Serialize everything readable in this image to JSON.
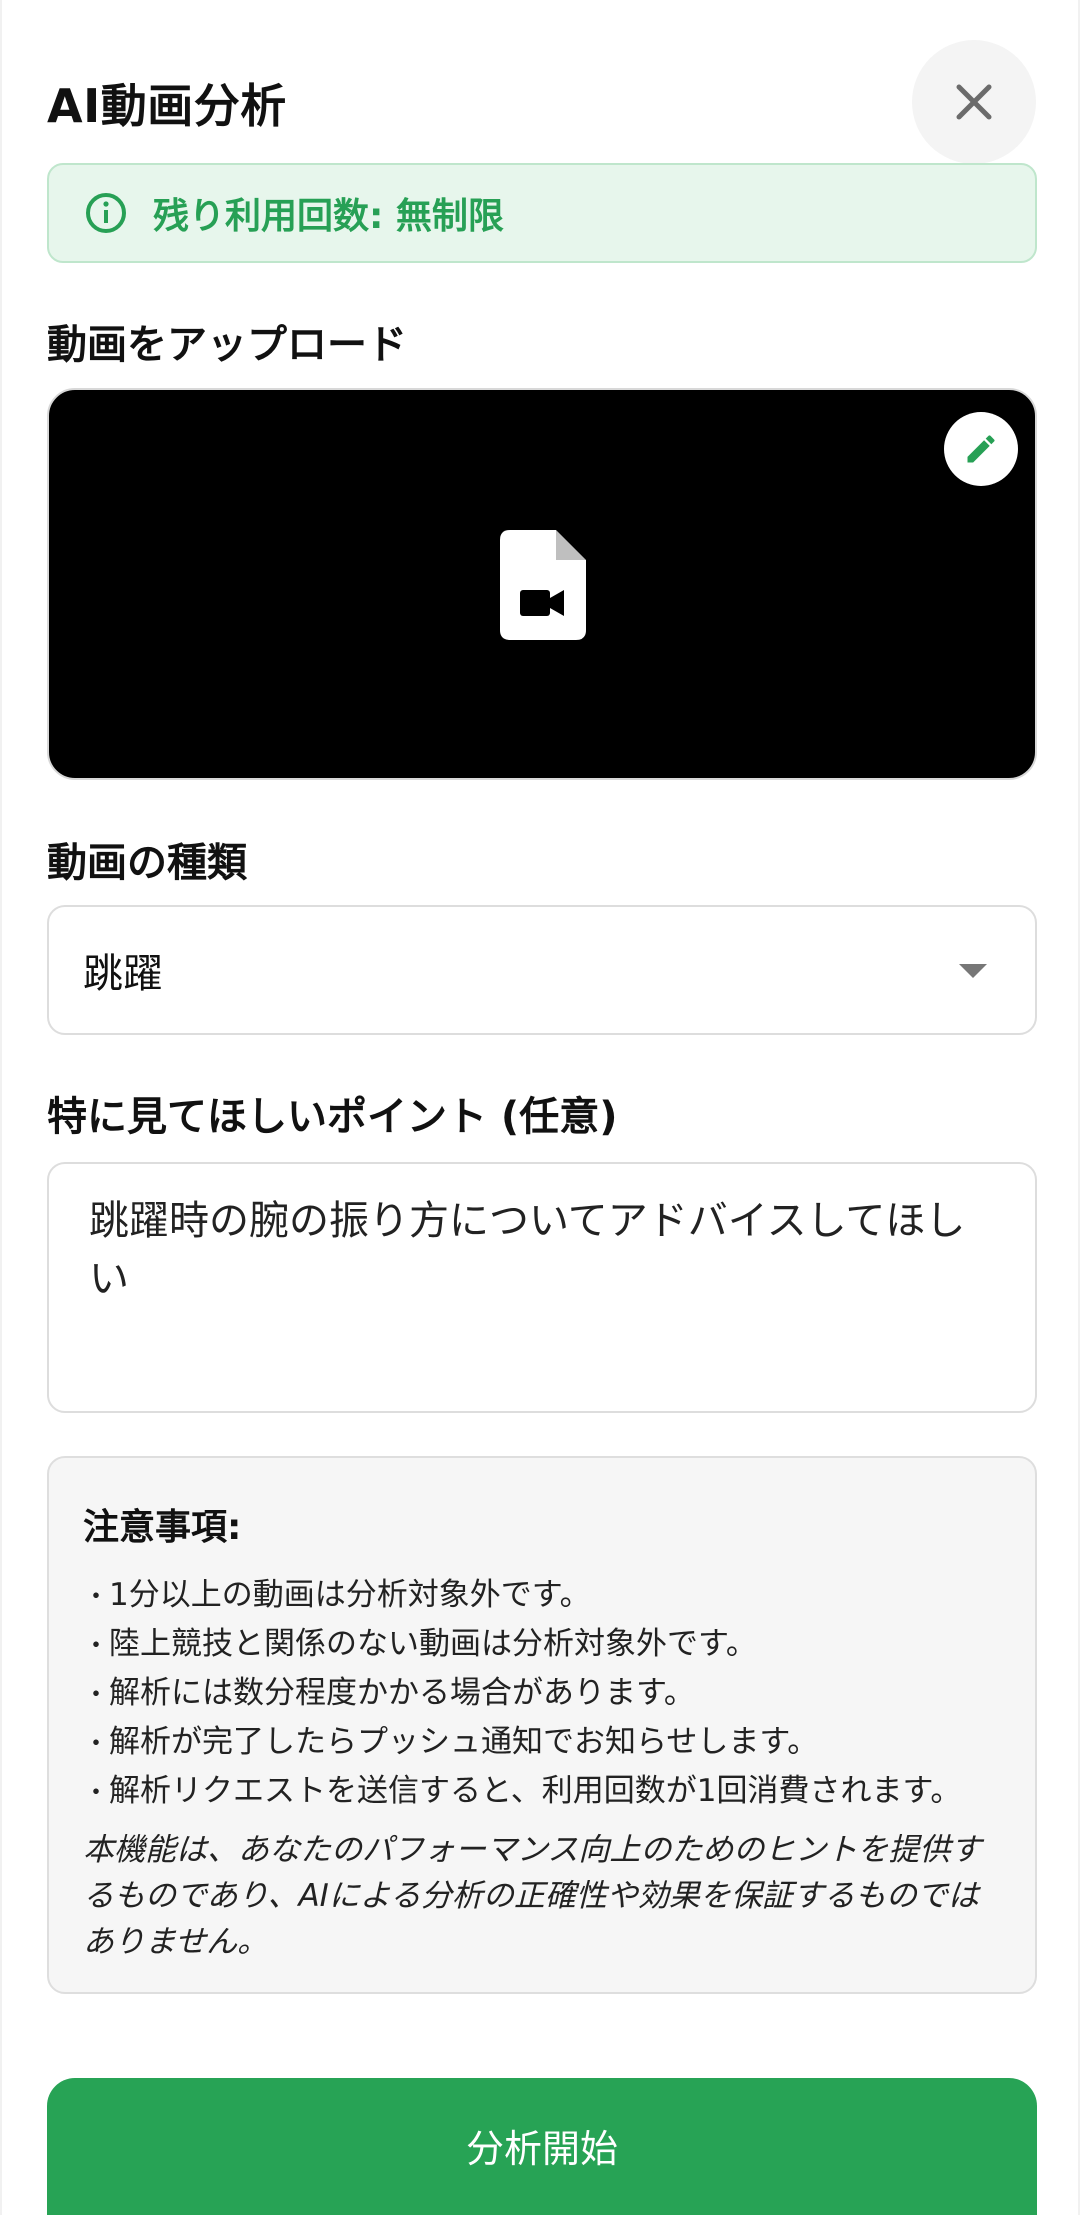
{
  "header": {
    "title": "AI動画分析",
    "close_icon": "close-icon"
  },
  "usage": {
    "text": "残り利用回数: 無制限",
    "icon": "info-icon",
    "color": "#27a055"
  },
  "upload": {
    "label": "動画をアップロード",
    "preview_icon": "video-file-icon",
    "edit_icon": "pencil-icon"
  },
  "video_type": {
    "label": "動画の種類",
    "selected": "跳躍"
  },
  "points": {
    "label": "特に見てほしいポイント (任意)",
    "value": "跳躍時の腕の振り方についてアドバイスしてほしい"
  },
  "notice": {
    "title": "注意事項:",
    "items": [
      "1分以上の動画は分析対象外です。",
      "陸上競技と関係のない動画は分析対象外です。",
      "解析には数分程度かかる場合があります。",
      "解析が完了したらプッシュ通知でお知らせします。",
      "解析リクエストを送信すると、利用回数が1回消費されます。"
    ],
    "disclaimer": "本機能は、あなたのパフォーマンス向上のためのヒントを提供するものであり、AIによる分析の正確性や効果を保証するものではありません。"
  },
  "submit": {
    "label": "分析開始",
    "color": "#27a355"
  }
}
